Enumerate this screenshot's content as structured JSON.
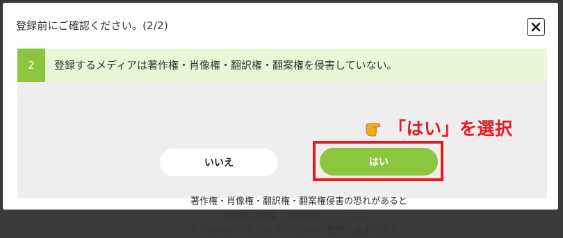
{
  "dialog": {
    "title": "登録前にご確認ください。(2/2)",
    "close_icon": "close-x-icon"
  },
  "question": {
    "number": "2",
    "text": "登録するメディアは著作権・肖像権・翻訳権・翻案権を侵害していない。"
  },
  "buttons": {
    "no_label": "いいえ",
    "yes_label": "はい"
  },
  "annotation": {
    "icon": "pointing-hand-icon",
    "text": "「はい」を選択"
  },
  "notice": {
    "lines": [
      "著作権・肖像権・翻訳権・翻案権侵害の恐れがあると",
      "登録後の審査で登録削除となります。",
      "X（Twitter）などのアイコンへの使用も含まれます。"
    ]
  },
  "colors": {
    "accent_green": "#8cc63f",
    "header_bg": "#eaf6d8",
    "highlight_red": "#e5191f",
    "panel_bg": "#eeeeee",
    "overlay_bg": "#3a3a3a"
  }
}
